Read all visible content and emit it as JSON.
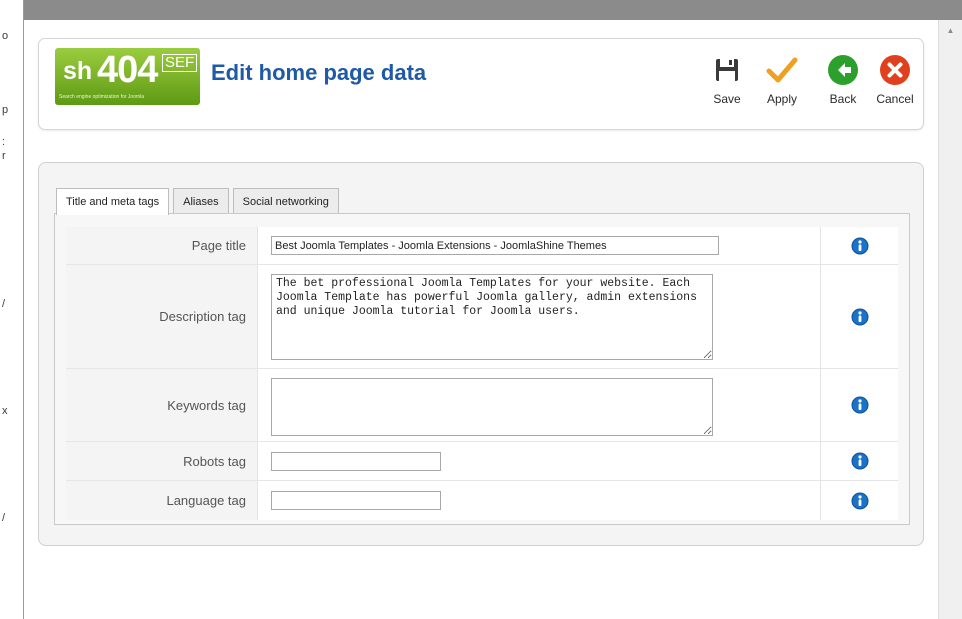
{
  "background": {
    "fragments": [
      "o",
      "p",
      ":",
      "r",
      "/",
      "x",
      "/"
    ]
  },
  "logo": {
    "prefix": "sh",
    "number": "404",
    "suffix": "SEF",
    "tagline": "Search engine optimization for Joomla"
  },
  "header": {
    "title": "Edit home page data"
  },
  "toolbar": {
    "save": "Save",
    "apply": "Apply",
    "back": "Back",
    "cancel": "Cancel"
  },
  "tabs": [
    {
      "label": "Title and meta tags",
      "active": true
    },
    {
      "label": "Aliases",
      "active": false
    },
    {
      "label": "Social networking",
      "active": false
    }
  ],
  "form": {
    "page_title": {
      "label": "Page title",
      "value": "Best Joomla Templates - Joomla Extensions - JoomlaShine Themes"
    },
    "description": {
      "label": "Description tag",
      "value": "The bet professional Joomla Templates for your website. Each Joomla Template has powerful Joomla gallery, admin extensions and unique Joomla tutorial for Joomla users."
    },
    "keywords": {
      "label": "Keywords tag",
      "value": ""
    },
    "robots": {
      "label": "Robots tag",
      "value": ""
    },
    "language": {
      "label": "Language tag",
      "value": ""
    }
  },
  "colors": {
    "title_blue": "#1f5aa6",
    "logo_green": "#7ab32e",
    "apply_orange": "#f0a020",
    "back_green": "#2ca02c",
    "cancel_red": "#e0401e",
    "info_blue": "#1a73c8"
  },
  "icons": {
    "save": "floppy-disk-icon",
    "apply": "checkmark-icon",
    "back": "arrow-left-circle-icon",
    "cancel": "x-circle-icon",
    "info": "info-icon"
  }
}
